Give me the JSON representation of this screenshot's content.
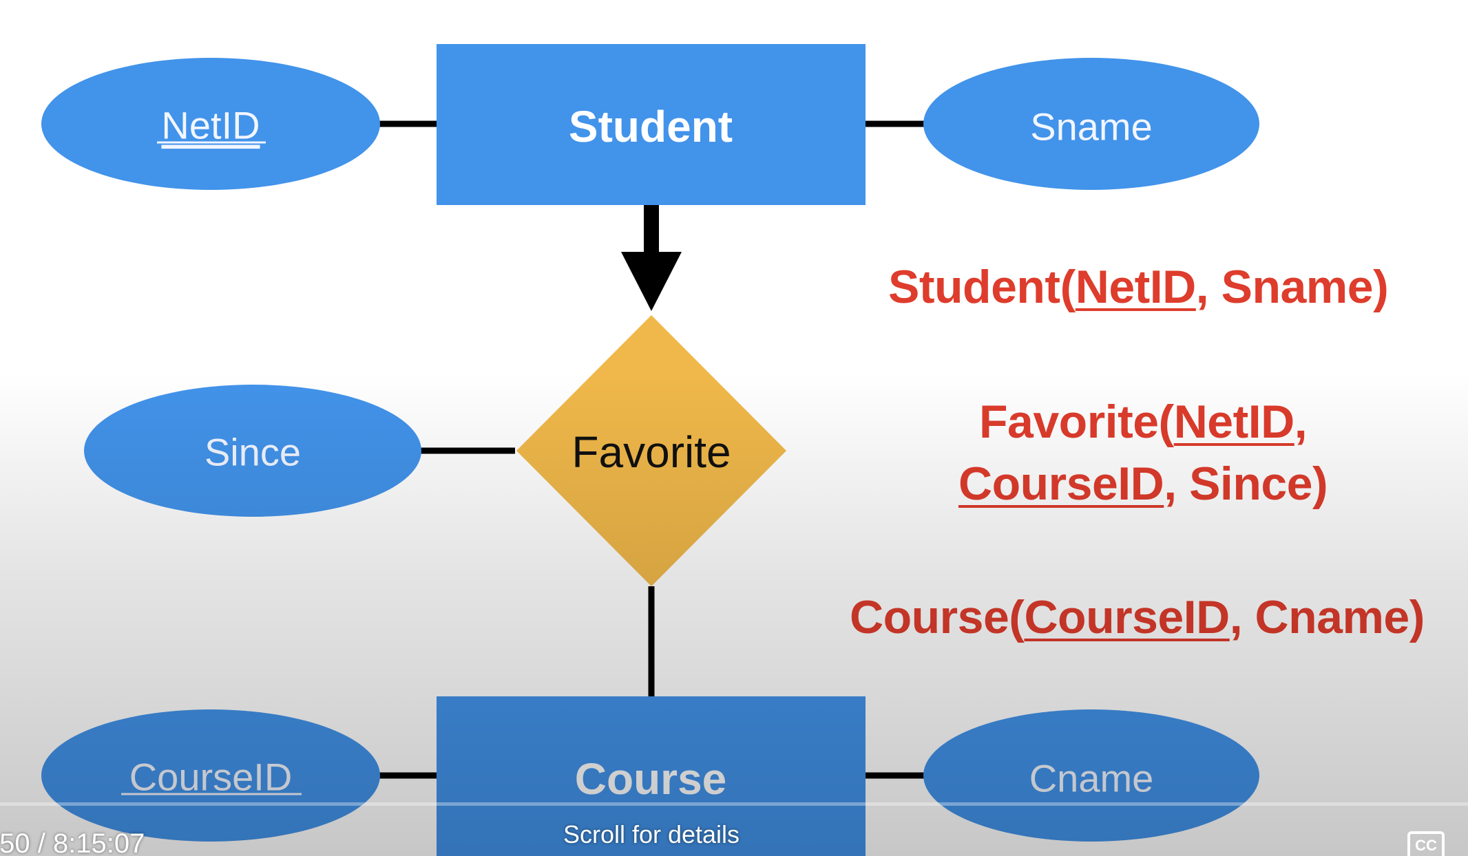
{
  "diagram": {
    "entities": {
      "student": "Student",
      "course": "Course"
    },
    "relationship": "Favorite",
    "attributes": {
      "netid": "NetID",
      "sname": "Sname",
      "since": "Since",
      "courseid": "CourseID",
      "cname": "Cname"
    },
    "colors": {
      "entity": "#4293ea",
      "attribute": "#4293ea",
      "relationship": "#f0b84a",
      "schema_text": "#de3c2c"
    }
  },
  "schema": {
    "student": {
      "name": "Student(",
      "key": "NetID",
      "rest": ", Sname)"
    },
    "favorite": {
      "name": "Favorite(",
      "key1": "NetID",
      "sep": ",",
      "key2": "CourseID",
      "rest": ", Since)"
    },
    "course": {
      "name": "Course(",
      "key": "CourseID",
      "rest": ", Cname)"
    }
  },
  "player": {
    "time": ":50 / 8:15:07",
    "scroll_hint": "Scroll for details",
    "cc_label": "CC"
  }
}
